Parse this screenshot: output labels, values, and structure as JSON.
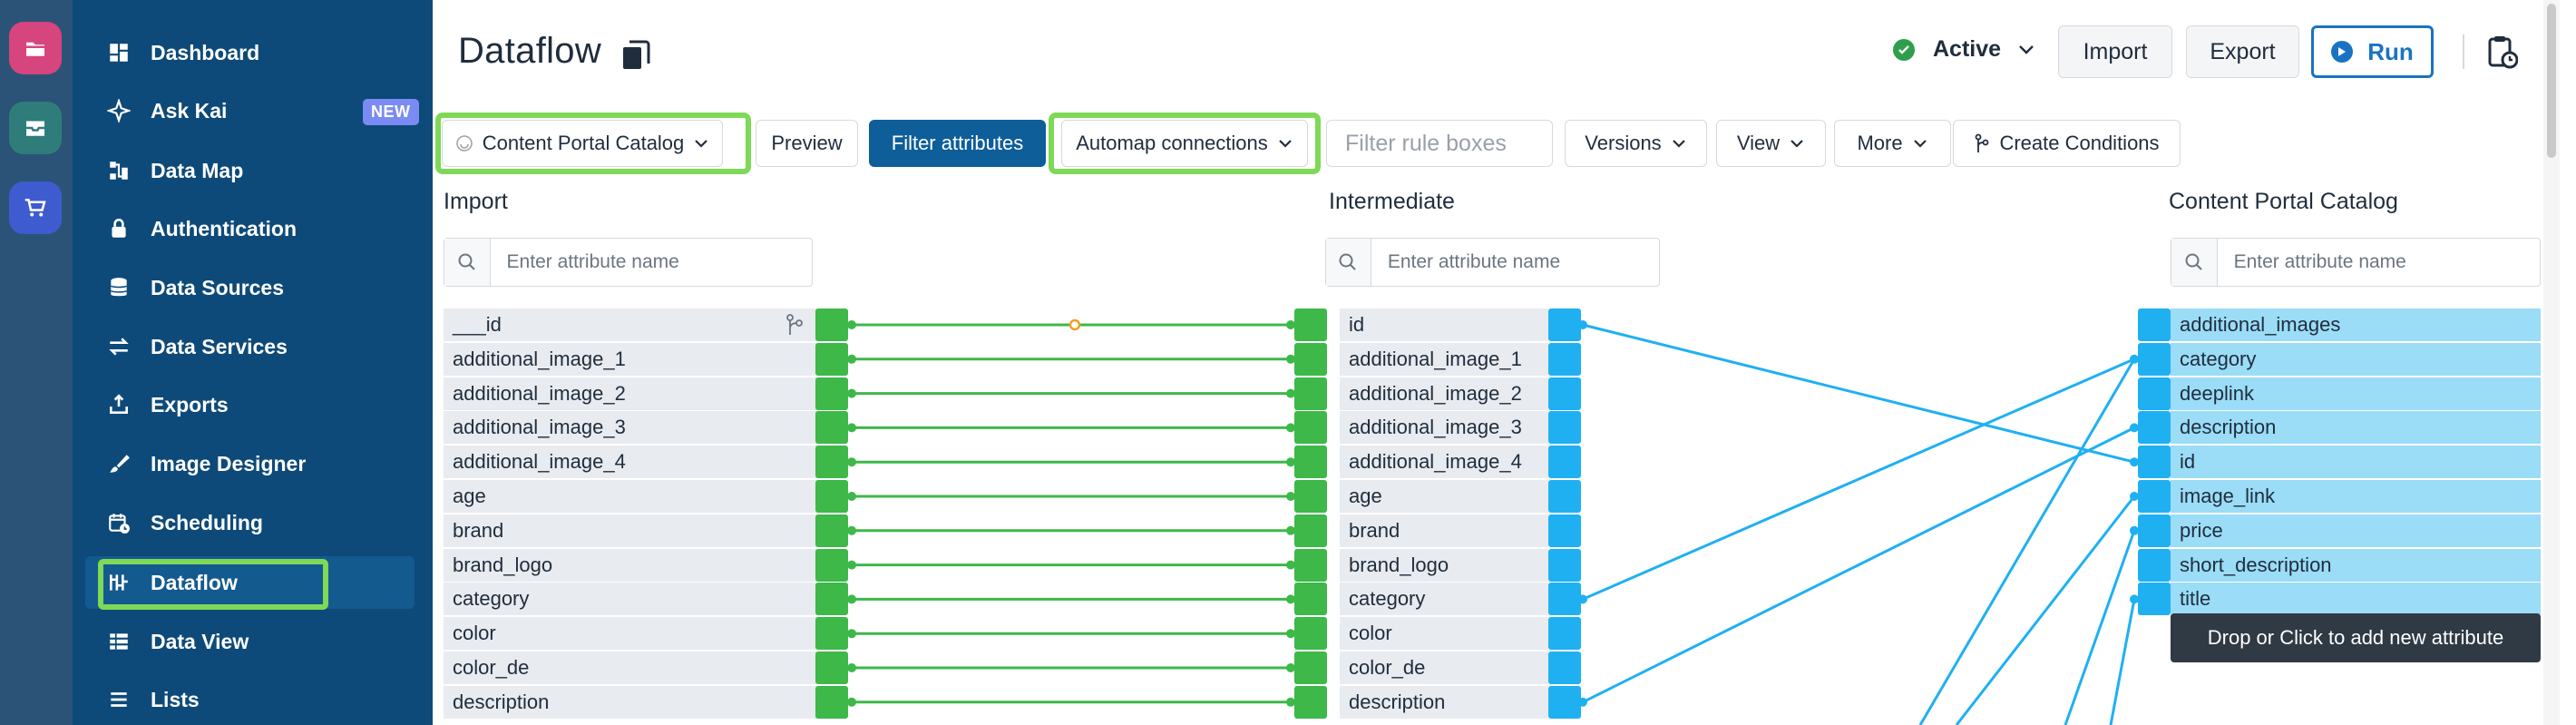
{
  "rail": {
    "items": [
      {
        "icon": "folder-icon",
        "color": "#d6457e"
      },
      {
        "icon": "inbox-icon",
        "color": "#2e7d7b"
      },
      {
        "icon": "cart-icon",
        "color": "#3f5bd0"
      }
    ]
  },
  "sidebar": {
    "items": [
      {
        "label": "Dashboard",
        "icon": "dashboard-icon"
      },
      {
        "label": "Ask Kai",
        "icon": "sparkle-icon",
        "badge": "NEW"
      },
      {
        "label": "Data Map",
        "icon": "data-map-icon"
      },
      {
        "label": "Authentication",
        "icon": "lock-icon"
      },
      {
        "label": "Data Sources",
        "icon": "database-icon"
      },
      {
        "label": "Data Services",
        "icon": "arrows-icon"
      },
      {
        "label": "Exports",
        "icon": "export-icon"
      },
      {
        "label": "Image Designer",
        "icon": "brush-icon"
      },
      {
        "label": "Scheduling",
        "icon": "calendar-icon"
      },
      {
        "label": "Dataflow",
        "icon": "dataflow-icon",
        "active": true
      },
      {
        "label": "Data View",
        "icon": "table-icon"
      },
      {
        "label": "Lists",
        "icon": "list-icon"
      }
    ]
  },
  "header": {
    "title": "Dataflow",
    "status": "Active",
    "import_label": "Import",
    "export_label": "Export",
    "run_label": "Run"
  },
  "toolbar": {
    "catalog_label": "Content Portal Catalog",
    "preview_label": "Preview",
    "filter_attributes_label": "Filter attributes",
    "automap_label": "Automap connections",
    "filter_rule_placeholder": "Filter rule boxes",
    "versions_label": "Versions",
    "view_label": "View",
    "more_label": "More",
    "create_conditions_label": "Create Conditions"
  },
  "columns": {
    "import": {
      "title": "Import",
      "search_placeholder": "Enter attribute name",
      "rows": [
        "___id",
        "additional_image_1",
        "additional_image_2",
        "additional_image_3",
        "additional_image_4",
        "age",
        "brand",
        "brand_logo",
        "category",
        "color",
        "color_de",
        "description"
      ]
    },
    "intermediate": {
      "title": "Intermediate",
      "search_placeholder": "Enter attribute name",
      "rows": [
        "id",
        "additional_image_1",
        "additional_image_2",
        "additional_image_3",
        "additional_image_4",
        "age",
        "brand",
        "brand_logo",
        "category",
        "color",
        "color_de",
        "description"
      ]
    },
    "target": {
      "title": "Content Portal Catalog",
      "search_placeholder": "Enter attribute name",
      "rows": [
        "additional_images",
        "category",
        "deeplink",
        "description",
        "id",
        "image_link",
        "price",
        "short_description",
        "title"
      ],
      "add_label": "Drop or Click to add new attribute"
    }
  },
  "colors": {
    "accent": "#1a73c2",
    "import_connector": "#3db849",
    "target_connector": "#1fb0f2",
    "highlight_outline": "#7ed957",
    "sidebar_bg": "#0d4a79"
  }
}
